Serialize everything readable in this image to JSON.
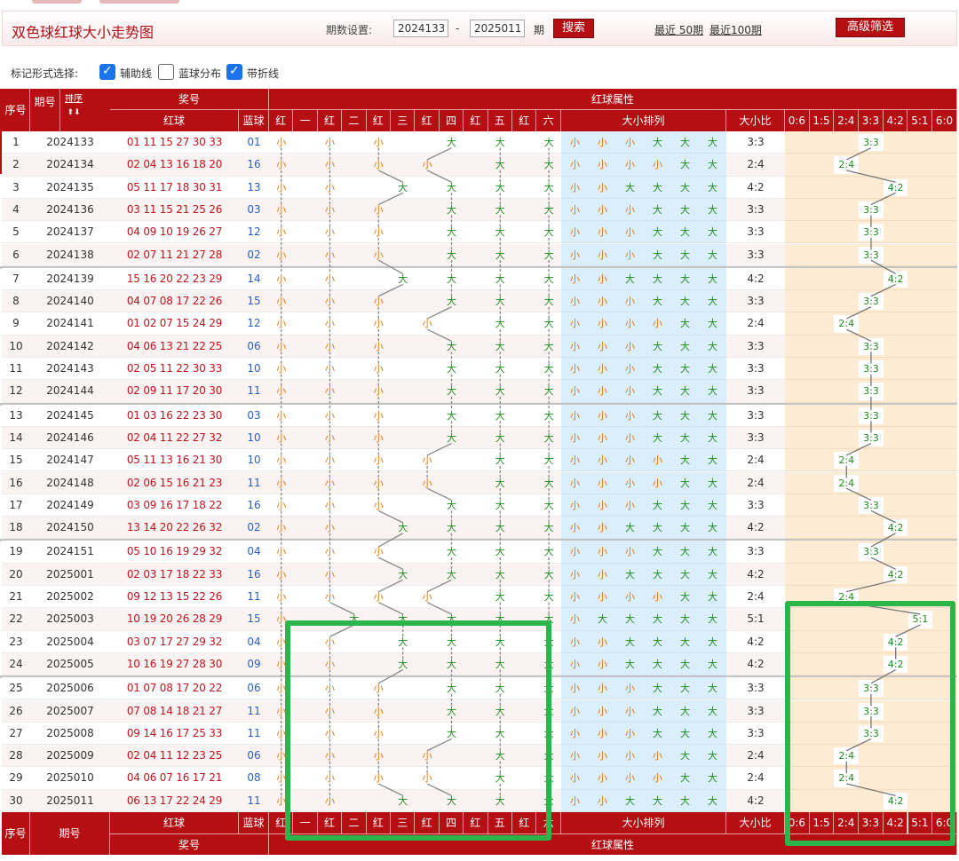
{
  "title": "双色球红球大小走势图",
  "controls": {
    "period_label": "期数设置:",
    "from": "2024133",
    "to": "2025011",
    "dash": "-",
    "unit": "期",
    "search_label": "搜索",
    "recent50": "最近 50期",
    "recent100": "最近100期",
    "advanced_label": "高级筛选"
  },
  "marks": {
    "label": "标记形式选择:",
    "options": [
      {
        "label": "辅助线",
        "checked": true
      },
      {
        "label": "蓝球分布",
        "checked": false
      },
      {
        "label": "带折线",
        "checked": true
      }
    ]
  },
  "header": {
    "seq": "序号",
    "issue": "期号",
    "sort": "排序",
    "prize": "奖号",
    "red_attr": "红球属性",
    "red": "红球",
    "blue": "蓝球",
    "pos_labels": [
      "红",
      "一",
      "红",
      "二",
      "红",
      "三",
      "红",
      "四",
      "红",
      "五",
      "红",
      "六"
    ],
    "order": "大小排列",
    "ratio": "大小比",
    "ratios": [
      "0:6",
      "1:5",
      "2:4",
      "3:3",
      "4:2",
      "5:1",
      "6:0"
    ]
  },
  "rows": [
    {
      "seq": "1",
      "issue": "2024133",
      "red": "01 11 15 27 30 33",
      "blue": "01",
      "ratio": "3:3"
    },
    {
      "seq": "2",
      "issue": "2024134",
      "red": "02 04 13 16 18 20",
      "blue": "16",
      "ratio": "2:4"
    },
    {
      "seq": "3",
      "issue": "2024135",
      "red": "05 11 17 18 30 31",
      "blue": "13",
      "ratio": "4:2"
    },
    {
      "seq": "4",
      "issue": "2024136",
      "red": "03 11 15 21 25 26",
      "blue": "03",
      "ratio": "3:3"
    },
    {
      "seq": "5",
      "issue": "2024137",
      "red": "04 09 10 19 26 27",
      "blue": "12",
      "ratio": "3:3"
    },
    {
      "seq": "6",
      "issue": "2024138",
      "red": "02 07 11 21 27 28",
      "blue": "02",
      "ratio": "3:3"
    },
    {
      "seq": "7",
      "issue": "2024139",
      "red": "15 16 20 22 23 29",
      "blue": "14",
      "ratio": "4:2"
    },
    {
      "seq": "8",
      "issue": "2024140",
      "red": "04 07 08 17 22 26",
      "blue": "15",
      "ratio": "3:3"
    },
    {
      "seq": "9",
      "issue": "2024141",
      "red": "01 02 07 15 24 29",
      "blue": "12",
      "ratio": "2:4"
    },
    {
      "seq": "10",
      "issue": "2024142",
      "red": "04 06 13 21 22 25",
      "blue": "06",
      "ratio": "3:3"
    },
    {
      "seq": "11",
      "issue": "2024143",
      "red": "02 05 11 22 30 33",
      "blue": "10",
      "ratio": "3:3"
    },
    {
      "seq": "12",
      "issue": "2024144",
      "red": "02 09 11 17 20 30",
      "blue": "11",
      "ratio": "3:3"
    },
    {
      "seq": "13",
      "issue": "2024145",
      "red": "01 03 16 22 23 30",
      "blue": "03",
      "ratio": "3:3"
    },
    {
      "seq": "14",
      "issue": "2024146",
      "red": "02 04 11 22 27 32",
      "blue": "10",
      "ratio": "3:3"
    },
    {
      "seq": "15",
      "issue": "2024147",
      "red": "05 11 13 16 21 30",
      "blue": "10",
      "ratio": "2:4"
    },
    {
      "seq": "16",
      "issue": "2024148",
      "red": "02 06 15 16 21 23",
      "blue": "11",
      "ratio": "2:4"
    },
    {
      "seq": "17",
      "issue": "2024149",
      "red": "03 09 16 17 18 22",
      "blue": "16",
      "ratio": "3:3"
    },
    {
      "seq": "18",
      "issue": "2024150",
      "red": "13 14 20 22 26 32",
      "blue": "02",
      "ratio": "4:2"
    },
    {
      "seq": "19",
      "issue": "2024151",
      "red": "05 10 16 19 29 32",
      "blue": "04",
      "ratio": "3:3"
    },
    {
      "seq": "20",
      "issue": "2025001",
      "red": "02 03 17 18 22 33",
      "blue": "16",
      "ratio": "4:2"
    },
    {
      "seq": "21",
      "issue": "2025002",
      "red": "09 12 13 15 22 26",
      "blue": "11",
      "ratio": "2:4"
    },
    {
      "seq": "22",
      "issue": "2025003",
      "red": "10 19 20 26 28 29",
      "blue": "15",
      "ratio": "5:1"
    },
    {
      "seq": "23",
      "issue": "2025004",
      "red": "03 07 17 27 29 32",
      "blue": "04",
      "ratio": "4:2"
    },
    {
      "seq": "24",
      "issue": "2025005",
      "red": "10 16 19 27 28 30",
      "blue": "09",
      "ratio": "4:2"
    },
    {
      "seq": "25",
      "issue": "2025006",
      "red": "01 07 08 17 20 22",
      "blue": "06",
      "ratio": "3:3"
    },
    {
      "seq": "26",
      "issue": "2025007",
      "red": "07 08 14 18 21 27",
      "blue": "11",
      "ratio": "3:3"
    },
    {
      "seq": "27",
      "issue": "2025008",
      "red": "09 14 16 17 25 33",
      "blue": "11",
      "ratio": "3:3"
    },
    {
      "seq": "28",
      "issue": "2025009",
      "red": "02 04 11 12 23 25",
      "blue": "06",
      "ratio": "2:4"
    },
    {
      "seq": "29",
      "issue": "2025010",
      "red": "04 06 07 16 17 21",
      "blue": "08",
      "ratio": "2:4"
    },
    {
      "seq": "30",
      "issue": "2025011",
      "red": "06 13 17 22 24 29",
      "blue": "11",
      "ratio": "4:2"
    }
  ],
  "symbols": {
    "small": "小",
    "big": "大"
  },
  "colors": {
    "header_red": "#b50f14",
    "red_number": "#c0141c",
    "blue_number": "#2a62c0",
    "small": "#e07a10",
    "big": "#1f8c1f",
    "order_bg": "#dbeefb",
    "ratio_bg": "#fdebd3",
    "highlight": "#2bb54a"
  }
}
